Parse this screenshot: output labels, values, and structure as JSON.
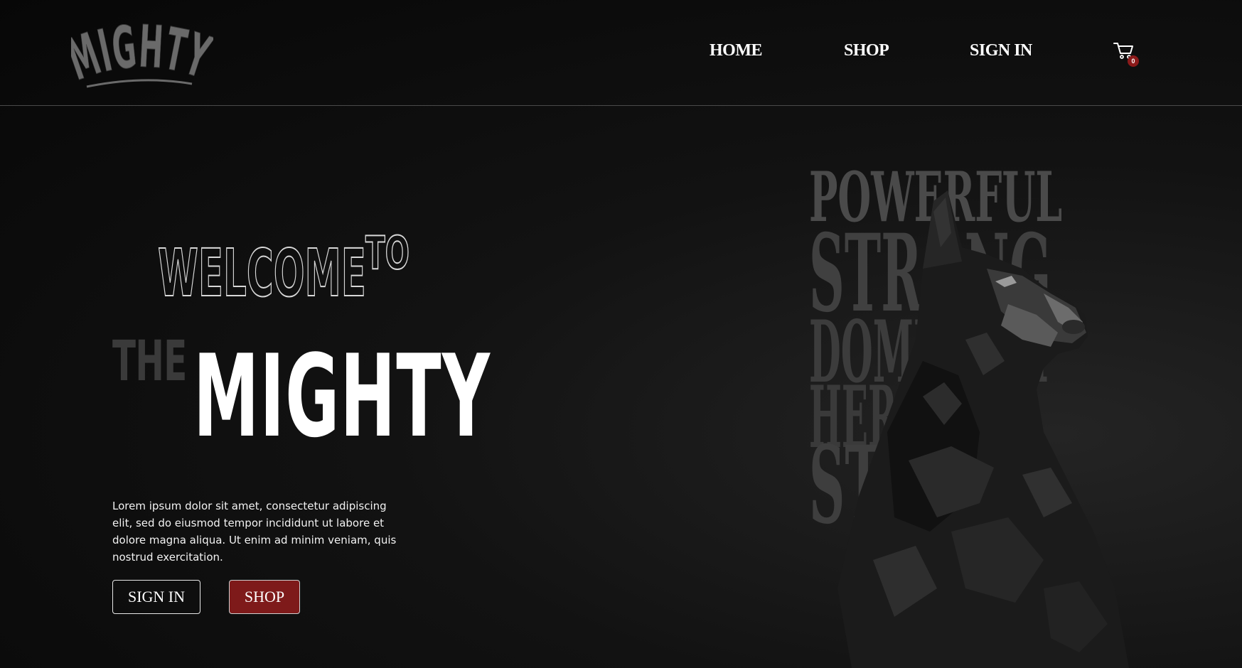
{
  "header": {
    "logo_text": "MIGHTY",
    "nav": {
      "home": "HOME",
      "shop": "SHOP",
      "signin": "SIGN IN"
    },
    "cart": {
      "icon": "cart-icon",
      "count": "0",
      "badge_color": "#8b1a1a"
    }
  },
  "hero": {
    "welcome": "WELCOME",
    "to": "TO",
    "the": "THE",
    "mighty": "MIGHTY",
    "description": "Lorem ipsum dolor sit amet, consectetur adipiscing elit, sed do eiusmod tempor incididunt ut labore et dolore magna aliqua. Ut enim ad minim veniam, quis nostrud exercitation.",
    "buttons": {
      "signin": "SIGN IN",
      "shop": "SHOP"
    }
  },
  "poster": {
    "words": [
      "POWERFUL",
      "STRONG",
      "DOMINANT",
      "HEROMAN",
      "STRONG"
    ],
    "image": "doberman-illustration"
  },
  "colors": {
    "background": "#0a0a0a",
    "accent": "#7e1a1a",
    "text": "#ffffff",
    "muted": "#3a3a3a"
  }
}
